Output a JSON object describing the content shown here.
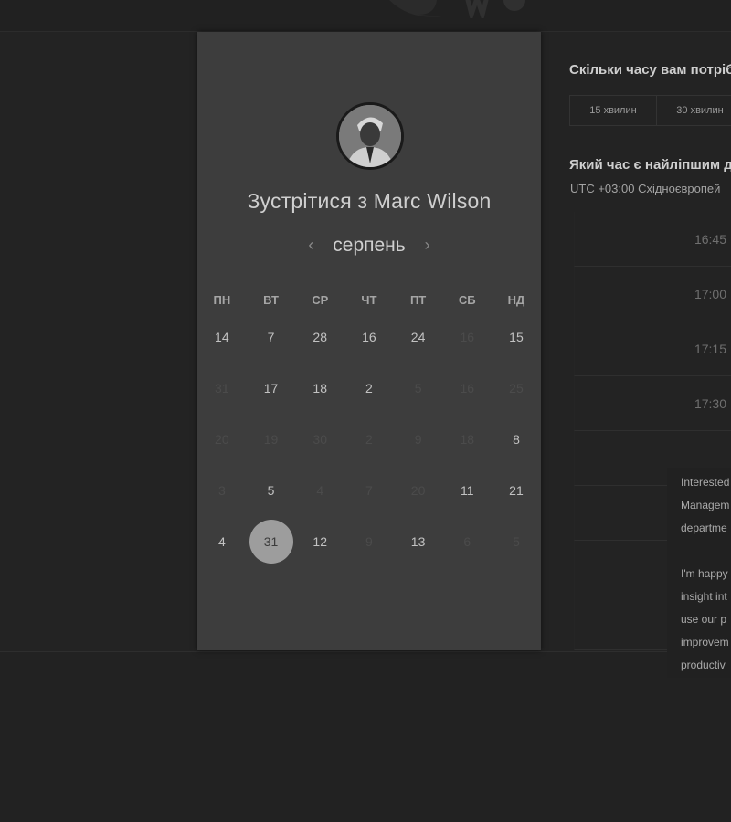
{
  "card": {
    "title": "Зустрітися з Marc Wilson",
    "month": "серпень",
    "weekdays": [
      "ПН",
      "ВТ",
      "СР",
      "ЧТ",
      "ПТ",
      "СБ",
      "НД"
    ],
    "weeks": [
      [
        {
          "d": "14",
          "s": "on"
        },
        {
          "d": "7",
          "s": "on"
        },
        {
          "d": "28",
          "s": "on"
        },
        {
          "d": "16",
          "s": "on"
        },
        {
          "d": "24",
          "s": "on"
        },
        {
          "d": "16",
          "s": "off"
        },
        {
          "d": "15",
          "s": "on"
        }
      ],
      [
        {
          "d": "31",
          "s": "off"
        },
        {
          "d": "17",
          "s": "on"
        },
        {
          "d": "18",
          "s": "on"
        },
        {
          "d": "2",
          "s": "on"
        },
        {
          "d": "5",
          "s": "off"
        },
        {
          "d": "16",
          "s": "off"
        },
        {
          "d": "25",
          "s": "off"
        }
      ],
      [
        {
          "d": "20",
          "s": "off"
        },
        {
          "d": "19",
          "s": "off"
        },
        {
          "d": "30",
          "s": "off"
        },
        {
          "d": "2",
          "s": "off"
        },
        {
          "d": "9",
          "s": "off"
        },
        {
          "d": "18",
          "s": "off"
        },
        {
          "d": "8",
          "s": "on"
        }
      ],
      [
        {
          "d": "3",
          "s": "off"
        },
        {
          "d": "5",
          "s": "on"
        },
        {
          "d": "4",
          "s": "off"
        },
        {
          "d": "7",
          "s": "off"
        },
        {
          "d": "20",
          "s": "off"
        },
        {
          "d": "11",
          "s": "on"
        },
        {
          "d": "21",
          "s": "on"
        }
      ],
      [
        {
          "d": "4",
          "s": "on"
        },
        {
          "d": "31",
          "s": "sel"
        },
        {
          "d": "12",
          "s": "on"
        },
        {
          "d": "9",
          "s": "off"
        },
        {
          "d": "13",
          "s": "on"
        },
        {
          "d": "6",
          "s": "off"
        },
        {
          "d": "5",
          "s": "off"
        }
      ]
    ]
  },
  "right": {
    "duration_question": "Скільки часу вам потріб",
    "durations": [
      "15 хвилин",
      "30 хвилин"
    ],
    "time_question": "Який час є найліпшим д",
    "timezone": "UTC +03:00 Східноєвропей",
    "slots": [
      "16:45",
      "17:00",
      "17:15",
      "17:30",
      "",
      "",
      "",
      ""
    ]
  },
  "popover": {
    "lines_1": [
      "Interested",
      "Managem",
      "departme"
    ],
    "lines_2": [
      "I'm happy",
      "insight int",
      "use our p",
      "improvem",
      "productiv"
    ]
  },
  "colors": {
    "card_bg": "#3d3d3d",
    "page_bg": "#222222",
    "selected_day": "#9d9d9d"
  }
}
